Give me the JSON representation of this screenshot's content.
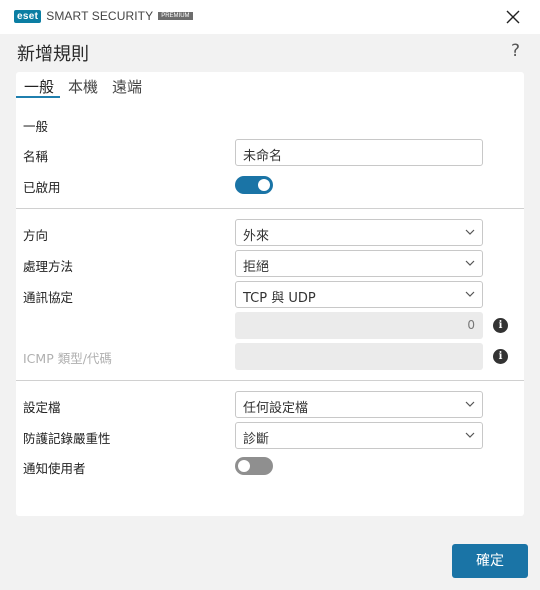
{
  "app": {
    "brand_badge": "eset",
    "product_name": "SMART SECURITY",
    "edition": "PREMIUM"
  },
  "dialog": {
    "title": "新增規則",
    "help": "?"
  },
  "tabs": [
    {
      "label": "一般",
      "active": true
    },
    {
      "label": "本機",
      "active": false
    },
    {
      "label": "遠端",
      "active": false
    }
  ],
  "general": {
    "section_label": "一般",
    "name_label": "名稱",
    "name_value": "未命名",
    "enabled_label": "已啟用",
    "enabled": true
  },
  "traffic": {
    "direction_label": "方向",
    "direction_value": "外來",
    "action_label": "處理方法",
    "action_value": "拒絕",
    "protocol_label": "通訊協定",
    "protocol_value": "TCP 與 UDP",
    "protocol_number": "0",
    "icmp_label": "ICMP 類型/代碼",
    "icmp_value": ""
  },
  "profile": {
    "profile_label": "設定檔",
    "profile_value": "任何設定檔",
    "log_label": "防護記錄嚴重性",
    "log_value": "診斷",
    "notify_label": "通知使用者",
    "notify": false
  },
  "footer": {
    "ok_label": "確定"
  },
  "colors": {
    "accent": "#1a74a6",
    "brand": "#0b7ea3"
  }
}
